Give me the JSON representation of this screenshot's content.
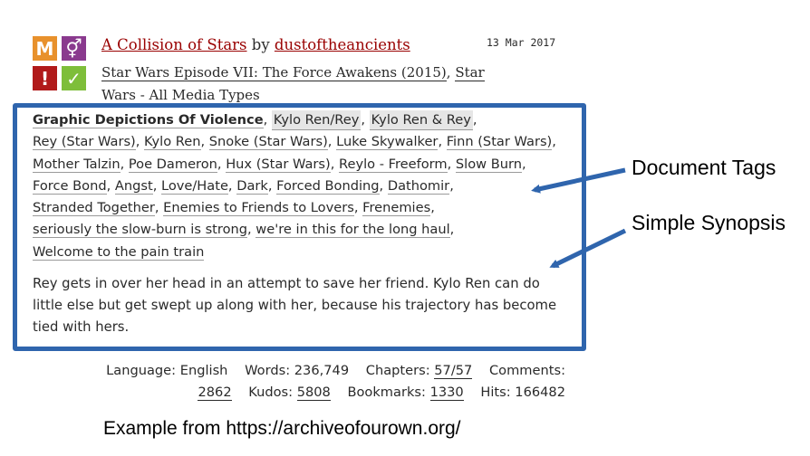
{
  "work": {
    "title": "A Collision of Stars",
    "by": "by",
    "author": "dustoftheancients",
    "date": "13 Mar 2017",
    "fandoms": [
      "Star Wars Episode VII: The Force Awakens (2015)",
      "Star Wars - All Media Types"
    ],
    "icons": [
      {
        "name": "rating-mature-icon",
        "glyph": "M",
        "color": "#e8912c"
      },
      {
        "name": "category-gender-icon",
        "glyph": "⚥",
        "color": "#8a3a8e"
      },
      {
        "name": "warnings-icon",
        "glyph": "!",
        "color": "#b11a1a"
      },
      {
        "name": "complete-check-icon",
        "glyph": "✓",
        "color": "#7ebe3a"
      }
    ]
  },
  "tags": {
    "warning": "Graphic Depictions Of Violence",
    "relationships": [
      "Kylo Ren/Rey",
      "Kylo Ren & Rey"
    ],
    "characters": [
      "Rey (Star Wars)",
      "Kylo Ren",
      "Snoke (Star Wars)",
      "Luke Skywalker",
      "Finn (Star Wars)",
      "Mother Talzin",
      "Poe Dameron",
      "Hux (Star Wars)"
    ],
    "freeforms": [
      "Reylo - Freeform",
      "Slow Burn",
      "Force Bond",
      "Angst",
      "Love/Hate",
      "Dark",
      "Forced Bonding",
      "Dathomir",
      "Stranded Together",
      "Enemies to Friends to Lovers",
      "Frenemies",
      "seriously the slow-burn is strong",
      "we're in this for the long haul",
      "Welcome to the pain train"
    ]
  },
  "summary": "Rey gets in over her head in an attempt to save her friend. Kylo Ren can do little else but get swept up along with her, because his trajectory has become tied with hers.",
  "stats": {
    "language_label": "Language:",
    "language": "English",
    "words_label": "Words:",
    "words": "236,749",
    "chapters_label": "Chapters:",
    "chapters": "57/57",
    "comments_label": "Comments:",
    "comments": "2862",
    "kudos_label": "Kudos:",
    "kudos": "5808",
    "bookmarks_label": "Bookmarks:",
    "bookmarks": "1330",
    "hits_label": "Hits:",
    "hits": "166482"
  },
  "annotations": {
    "document_tags": "Document Tags",
    "simple_synopsis": "Simple Synopsis",
    "caption": "Example from https://archiveofourown.org/",
    "accent": "#2f65ad"
  }
}
